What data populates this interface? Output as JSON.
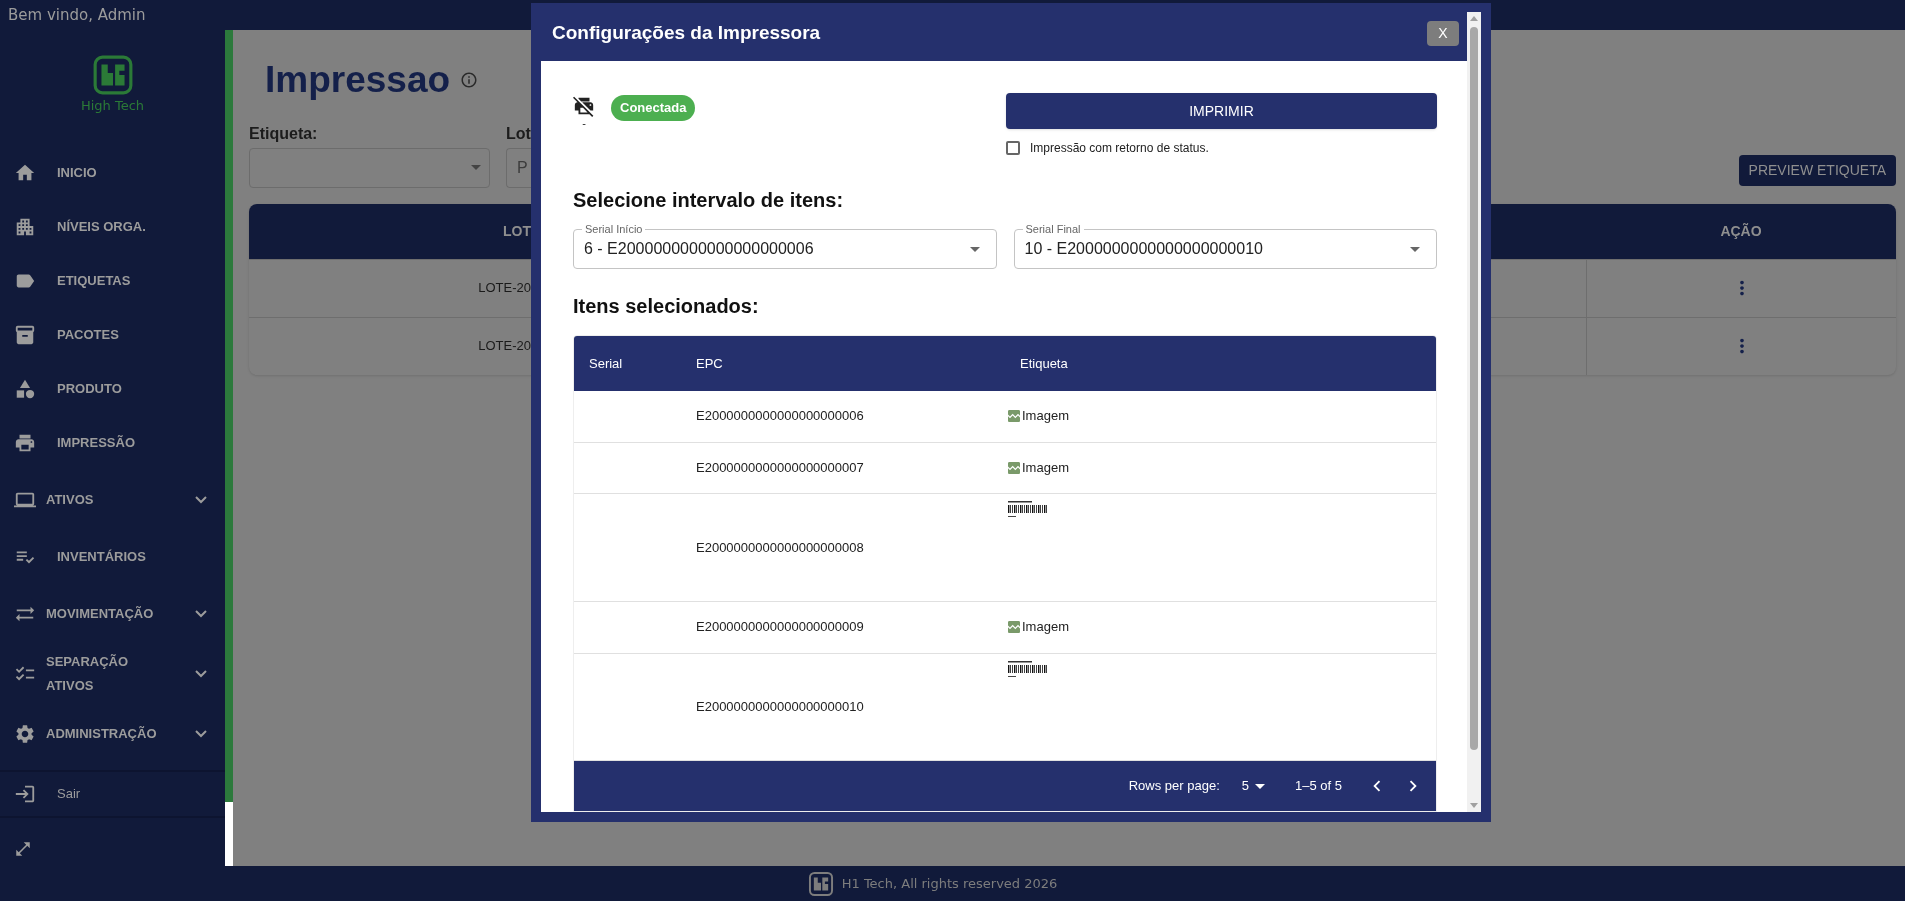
{
  "top_bar": {
    "greeting": "Bem vindo, Admin"
  },
  "sidebar": {
    "logo_text": "High Tech",
    "items": [
      {
        "label": "INICIO",
        "kind": "link"
      },
      {
        "label": "NÍVEIS ORGA.",
        "kind": "link"
      },
      {
        "label": "ETIQUETAS",
        "kind": "link"
      },
      {
        "label": "PACOTES",
        "kind": "link"
      },
      {
        "label": "PRODUTO",
        "kind": "link"
      },
      {
        "label": "IMPRESSÃO",
        "kind": "link"
      },
      {
        "label": "ATIVOS",
        "kind": "group",
        "expanded": false
      },
      {
        "label": "INVENTÁRIOS",
        "kind": "link"
      },
      {
        "label": "MOVIMENTAÇÃO",
        "kind": "group",
        "expanded": false
      },
      {
        "label": "SEPARAÇÃO ATIVOS",
        "kind": "group",
        "expanded": false
      },
      {
        "label": "ADMINISTRAÇÃO",
        "kind": "group",
        "expanded": false
      }
    ],
    "logout": "Sair"
  },
  "page": {
    "title": "Impressao",
    "filters": [
      {
        "label": "Etiqueta:",
        "kind": "select"
      },
      {
        "label": "Lot",
        "kind": "text",
        "placeholder": "P"
      }
    ],
    "preview_button": "PREVIEW ETIQUETA",
    "table": {
      "columns": [
        "LOT",
        "AÇÃO"
      ],
      "rows": [
        {
          "lot": "LOTE-20"
        },
        {
          "lot": "LOTE-20"
        }
      ]
    }
  },
  "dialog": {
    "title": "Configurações da Impressora",
    "close": "X",
    "printer": {
      "status": "Conectada",
      "name": "-"
    },
    "print_button": "IMPRIMIR",
    "status_return": {
      "label": "Impressão com retorno de status.",
      "checked": false
    },
    "range_heading": "Selecione intervalo de itens:",
    "range": [
      {
        "label": "Serial Início",
        "value": "6 - E2000000000000000000006"
      },
      {
        "label": "Serial Final",
        "value": "10 - E2000000000000000000010"
      }
    ],
    "selected_heading": "Itens selecionados:",
    "table": {
      "columns": [
        "Serial",
        "EPC",
        "Etiqueta"
      ],
      "rows": [
        {
          "epc": "E2000000000000000000006",
          "image": {
            "kind": "broken",
            "alt": "Imagem"
          }
        },
        {
          "epc": "E2000000000000000000007",
          "image": {
            "kind": "broken",
            "alt": "Imagem"
          }
        },
        {
          "epc": "E2000000000000000000008",
          "image": {
            "kind": "label"
          }
        },
        {
          "epc": "E2000000000000000000009",
          "image": {
            "kind": "broken",
            "alt": "Imagem"
          }
        },
        {
          "epc": "E2000000000000000000010",
          "image": {
            "kind": "label"
          }
        }
      ]
    },
    "pagination": {
      "rows_label": "Rows per page:",
      "rows_value": "5",
      "range": "1–5 of 5"
    }
  },
  "footer": {
    "text": "H1 Tech, All rights reserved 2026"
  }
}
